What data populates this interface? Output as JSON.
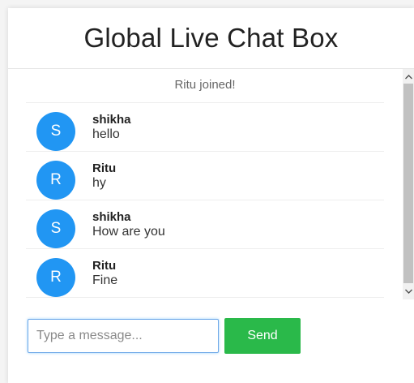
{
  "header": {
    "title": "Global Live Chat Box"
  },
  "system_message": "Ritu joined!",
  "messages": [
    {
      "initial": "S",
      "name": "shikha",
      "text": "hello"
    },
    {
      "initial": "R",
      "name": "Ritu",
      "text": "hy"
    },
    {
      "initial": "S",
      "name": "shikha",
      "text": "How are you"
    },
    {
      "initial": "R",
      "name": "Ritu",
      "text": "Fine"
    }
  ],
  "composer": {
    "placeholder": "Type a message...",
    "value": "",
    "send_label": "Send"
  },
  "colors": {
    "avatar": "#2196f3",
    "send_button": "#2ab94a",
    "input_focus_border": "#6ea8e8"
  },
  "icons": {
    "scroll_up": "chevron-up-icon",
    "scroll_down": "chevron-down-icon"
  }
}
